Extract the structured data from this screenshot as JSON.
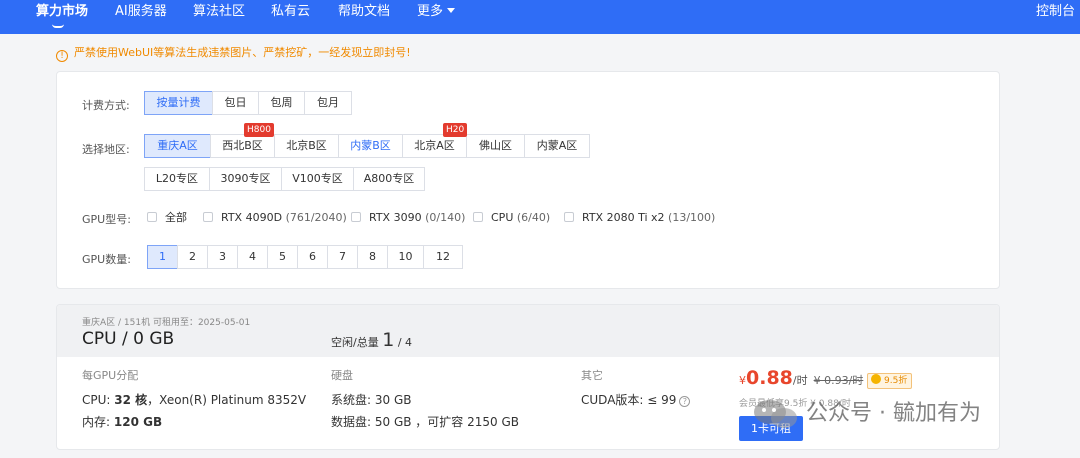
{
  "nav": {
    "items": [
      "算力市场",
      "AI服务器",
      "算法社区",
      "私有云",
      "帮助文档",
      "更多"
    ],
    "console": "控制台"
  },
  "warning": "严禁使用WebUI等算法生成违禁图片、严禁挖矿，一经发现立即封号!",
  "billing": {
    "label": "计费方式:",
    "options": [
      "按量计费",
      "包日",
      "包周",
      "包月"
    ],
    "selected": "按量计费"
  },
  "region": {
    "label": "选择地区:",
    "row1": [
      "重庆A区",
      "西北B区",
      "北京B区",
      "内蒙B区",
      "北京A区",
      "佛山区",
      "内蒙A区"
    ],
    "row2": [
      "L20专区",
      "3090专区",
      "V100专区",
      "A800专区"
    ],
    "selected": "重庆A区",
    "badges": [
      "H800",
      "H20"
    ]
  },
  "gpu_model": {
    "label": "GPU型号:",
    "options": [
      {
        "name": "全部",
        "count": ""
      },
      {
        "name": "RTX 4090D",
        "count": "(761/2040)"
      },
      {
        "name": "RTX 3090",
        "count": "(0/140)"
      },
      {
        "name": "CPU",
        "count": "(6/40)"
      },
      {
        "name": "RTX 2080 Ti x2",
        "count": "(13/100)"
      }
    ]
  },
  "gpu_count": {
    "label": "GPU数量:",
    "options": [
      "1",
      "2",
      "3",
      "4",
      "5",
      "6",
      "7",
      "8",
      "10",
      "12"
    ],
    "selected": "1"
  },
  "machine": {
    "meta": "重庆A区 / 151机   可租用至：2025-05-01",
    "name": "CPU / 0 GB",
    "availability_label": "空闲/总量",
    "available": "1",
    "total": "/ 4",
    "gpu_section": "每GPU分配",
    "cpu_label": "CPU:",
    "cpu_value": "32 核",
    "cpu_model": "，Xeon(R) Platinum 8352V",
    "mem_label": "内存:",
    "mem_value": "120 GB",
    "disk_section": "硬盘",
    "sys_disk": "系统盘:  30 GB",
    "data_disk": "数据盘:  50 GB ，可扩容 2150 GB",
    "other_section": "其它",
    "cuda": "CUDA版本:  ≤ 99",
    "currency": "¥",
    "price": "0.88",
    "price_unit": "/时",
    "orig_price": "¥ 0.93/时",
    "discount": "9.5折",
    "member_price": "会员最低享9.5折  ¥ 0.88/时",
    "rent_button": "1卡可租"
  },
  "watermark": "公众号 · 毓加有为",
  "colors": {
    "brand": "#2f6df6",
    "warning": "#f08a00",
    "price": "#e8462c",
    "badge": "#e33b2e"
  }
}
